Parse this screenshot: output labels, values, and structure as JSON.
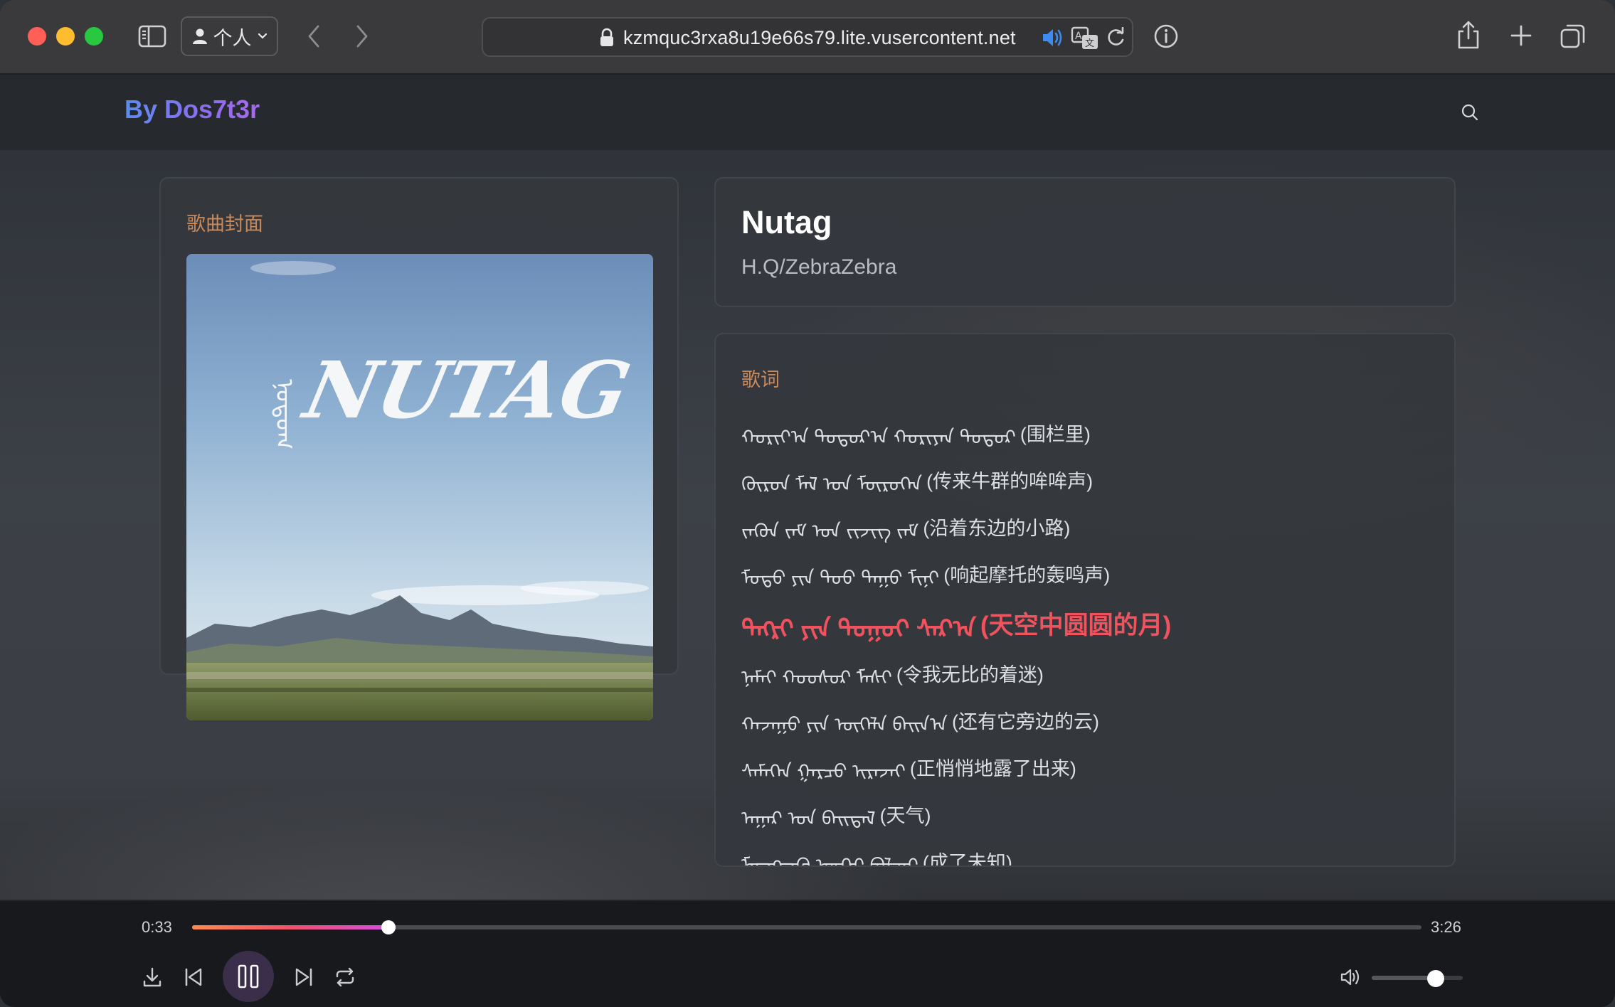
{
  "browser": {
    "profile_label": "个人",
    "url": "kzmquc3rxa8u19e66s79.lite.vusercontent.net"
  },
  "site": {
    "brand": "By Dos7t3r"
  },
  "cover": {
    "label": "歌曲封面",
    "art_text": "NUTAG"
  },
  "song": {
    "title": "Nutag",
    "artist": "H.Q/ZebraZebra"
  },
  "lyrics": {
    "label": "歌词",
    "lines": [
      {
        "mong": "ᠬᠣᠷᠢᠶ᠎ᠠ ᠳᠣᠲᠣᠷ᠎ᠠ ᠬᠣᠷᠢᠶᠠᠨ ᠳᠣᠲᠣᠷ",
        "text": "(围栏里)",
        "active": false
      },
      {
        "mong": "ᠬᠦᠷᠦᠨ ᠮᠠᠯ ᠤᠨ ᠮᠥᠷᠥᠭᠡᠨ",
        "text": "(传来牛群的哞哞声)",
        "active": false
      },
      {
        "mong": "ᠵᠡᠭᠦᠨ ᠵᠠᠮ ᠤᠨ ᠵᠢᠵᠢᠭ ᠵᠠᠮ",
        "text": "(沿着东边的小路)",
        "active": false
      },
      {
        "mong": "ᠮᠣᠲᠣ ᠶᠢᠨ ᠳᠤᠤ ᠳᠠᠭᠤ ᠮᠢᠨᠢ",
        "text": "(响起摩托的轰鸣声)",
        "active": false
      },
      {
        "mong": "ᠲᠩᠷᠢ ᠶᠢᠨ ᠳᠤᠭᠤᠢ ᠰᠠᠷ᠎ᠠ",
        "text": "(天空中圆圆的月)",
        "active": true
      },
      {
        "mong": "ᠨᠠᠮᠠᠢ ᠬᠣᠣᠰᠣᠷ ᠮᠠᠰᠢ",
        "text": "(令我无比的着迷)",
        "active": false
      },
      {
        "mong": "ᠬᠠᠵᠠᠭᠤ ᠶᠢᠨ ᠦᠭᠡᠯᠡ ᠪᠠᠢᠨ᠎ᠠ",
        "text": "(还有它旁边的云)",
        "active": false
      },
      {
        "mong": "ᠰᠡᠮᠡᠭᠡᠨ ᠭᠠᠷᠴᠤ ᠢᠷᠡᠵᠡᠢ",
        "text": "(正悄悄地露了出来)",
        "active": false
      },
      {
        "mong": "ᠠᠭᠠᠷ ᠤᠨ ᠪᠠᠢᠳᠠᠯ",
        "text": "(天气)",
        "active": false
      },
      {
        "mong": "ᠮᠡᠳᠡᠭᠳᠡᠬᠦ ᠦᠭᠡᠢ ᠪᠣᠯᠵᠠᠢ",
        "text": "(成了未知)",
        "active": false
      }
    ]
  },
  "player": {
    "current_time": "0:33",
    "total_time": "3:26",
    "progress": 0.16,
    "volume": 0.7
  },
  "colors": {
    "accent": "#f0525e",
    "label": "#c98a5a",
    "brand_start": "#5b8dee",
    "brand_end": "#a56ce8"
  },
  "icons": {
    "sidebar": "sidebar-icon",
    "back": "chevron-left-icon",
    "forward": "chevron-right-icon",
    "lock": "lock-icon",
    "audio": "speaker-icon",
    "translate": "translate-icon",
    "reload": "reload-icon",
    "info": "info-icon",
    "share": "share-icon",
    "new_tab": "plus-icon",
    "tabs": "tabs-overview-icon",
    "search": "search-icon",
    "download": "download-icon",
    "previous": "skip-back-icon",
    "pause": "pause-icon",
    "next": "skip-forward-icon",
    "repeat": "repeat-icon",
    "volume": "volume-icon"
  }
}
